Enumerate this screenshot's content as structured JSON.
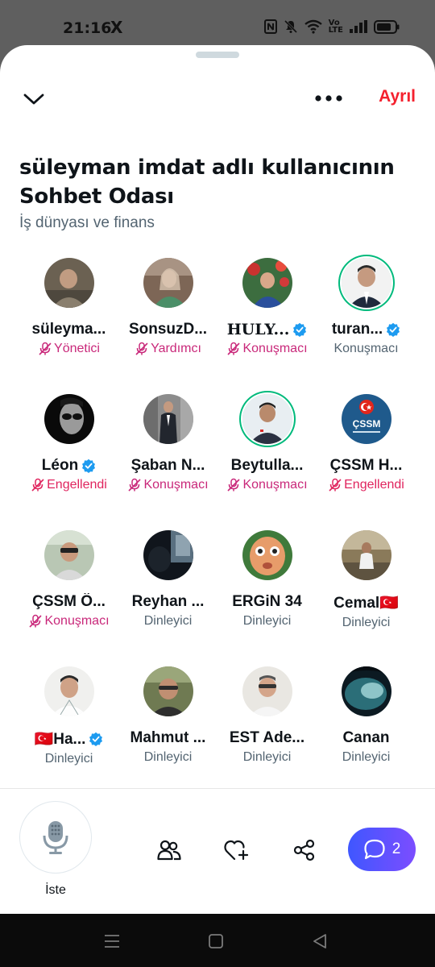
{
  "status_bar": {
    "time": "21:16",
    "x_logo": "X",
    "network_label_top": "Vo",
    "network_label_bottom": "LTE",
    "icons": [
      "nfc-icon",
      "mute-icon",
      "wifi-icon",
      "signal-icon",
      "battery-icon"
    ]
  },
  "header": {
    "leave_label": "Ayrıl",
    "leave_color": "#f4212e"
  },
  "room": {
    "title": "süleyman imdat adlı kullanıcının Sohbet Odası",
    "topic": "İş dünyası ve finans"
  },
  "participants": [
    {
      "name": "süleyma...",
      "role": "Yönetici",
      "muted": true,
      "verified": false
    },
    {
      "name": "SonsuzD...",
      "role": "Yardımcı",
      "muted": true,
      "verified": false
    },
    {
      "name": "HULY...",
      "role": "Konuşmacı",
      "muted": true,
      "verified": true
    },
    {
      "name": "turan...",
      "role": "Konuşmacı",
      "muted": false,
      "verified": true
    },
    {
      "name": "Léon",
      "role": "Engellendi",
      "muted": true,
      "verified": true
    },
    {
      "name": "Şaban N...",
      "role": "Konuşmacı",
      "muted": true,
      "verified": false
    },
    {
      "name": "Beytulla...",
      "role": "Konuşmacı",
      "muted": true,
      "verified": false
    },
    {
      "name": "ÇSSM H...",
      "role": "Engellendi",
      "muted": true,
      "verified": false
    },
    {
      "name": "ÇSSM Ö...",
      "role": "Konuşmacı",
      "muted": true,
      "verified": false
    },
    {
      "name": "Reyhan ...",
      "role": "Dinleyici",
      "muted": false,
      "verified": false
    },
    {
      "name": "ERGiN 34",
      "role": "Dinleyici",
      "muted": false,
      "verified": false
    },
    {
      "name": "Cemal🇹🇷",
      "role": "Dinleyici",
      "muted": false,
      "verified": false
    },
    {
      "name": "🇹🇷Ha...",
      "role": "Dinleyici",
      "muted": false,
      "verified": true
    },
    {
      "name": "Mahmut ...",
      "role": "Dinleyici",
      "muted": false,
      "verified": false
    },
    {
      "name": "EST Ade...",
      "role": "Dinleyici",
      "muted": false,
      "verified": false
    },
    {
      "name": "Canan",
      "role": "Dinleyici",
      "muted": false,
      "verified": false
    }
  ],
  "avatar_badge_text": "ÇSSM",
  "bottom_bar": {
    "request_label": "İste",
    "chat_count": "2",
    "chat_gradient": [
      "#3f57ff",
      "#7c4dff"
    ]
  },
  "colors": {
    "verified": "#1d9bf0",
    "muted_role": "#c9287a",
    "blocked_role": "#e0245e",
    "speaking_ring": "#00ba7c"
  }
}
